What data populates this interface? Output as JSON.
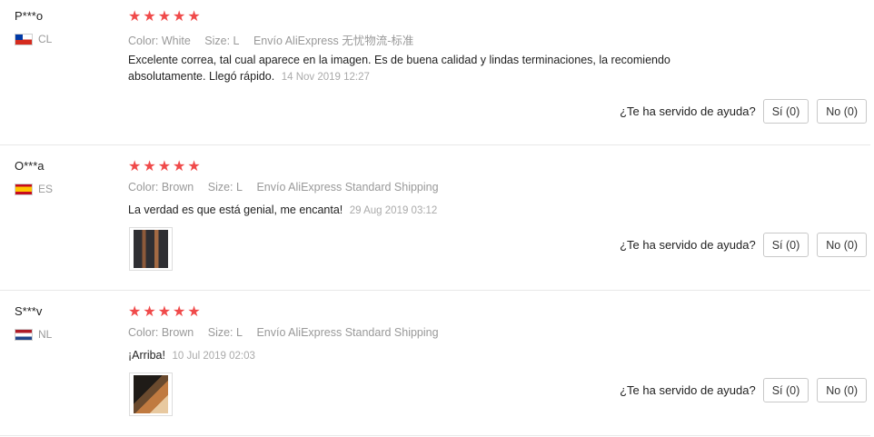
{
  "help_question": "¿Te ha servido de ayuda?",
  "reviews": [
    {
      "user": "P***o",
      "country": "CL",
      "stars": 5,
      "color": "Color: White",
      "size": "Size: L",
      "shipping": "Envío AliExpress 无忧物流-标准",
      "comment": "Excelente correa, tal cual aparece en la imagen. Es de buena calidad y lindas terminaciones, la recomiendo absolutamente. Llegó rápido.",
      "date": "14 Nov 2019 12:27",
      "yes": "Sí (0)",
      "no": "No (0)"
    },
    {
      "user": "O***a",
      "country": "ES",
      "stars": 5,
      "color": "Color: Brown",
      "size": "Size: L",
      "shipping": "Envío AliExpress Standard Shipping",
      "comment": "La verdad es que está genial, me encanta!",
      "date": "29 Aug 2019 03:12",
      "yes": "Sí (0)",
      "no": "No (0)"
    },
    {
      "user": "S***v",
      "country": "NL",
      "stars": 5,
      "color": "Color: Brown",
      "size": "Size: L",
      "shipping": "Envío AliExpress Standard Shipping",
      "comment": "¡Arriba!",
      "date": "10 Jul 2019 02:03",
      "yes": "Sí (0)",
      "no": "No (0)"
    }
  ]
}
